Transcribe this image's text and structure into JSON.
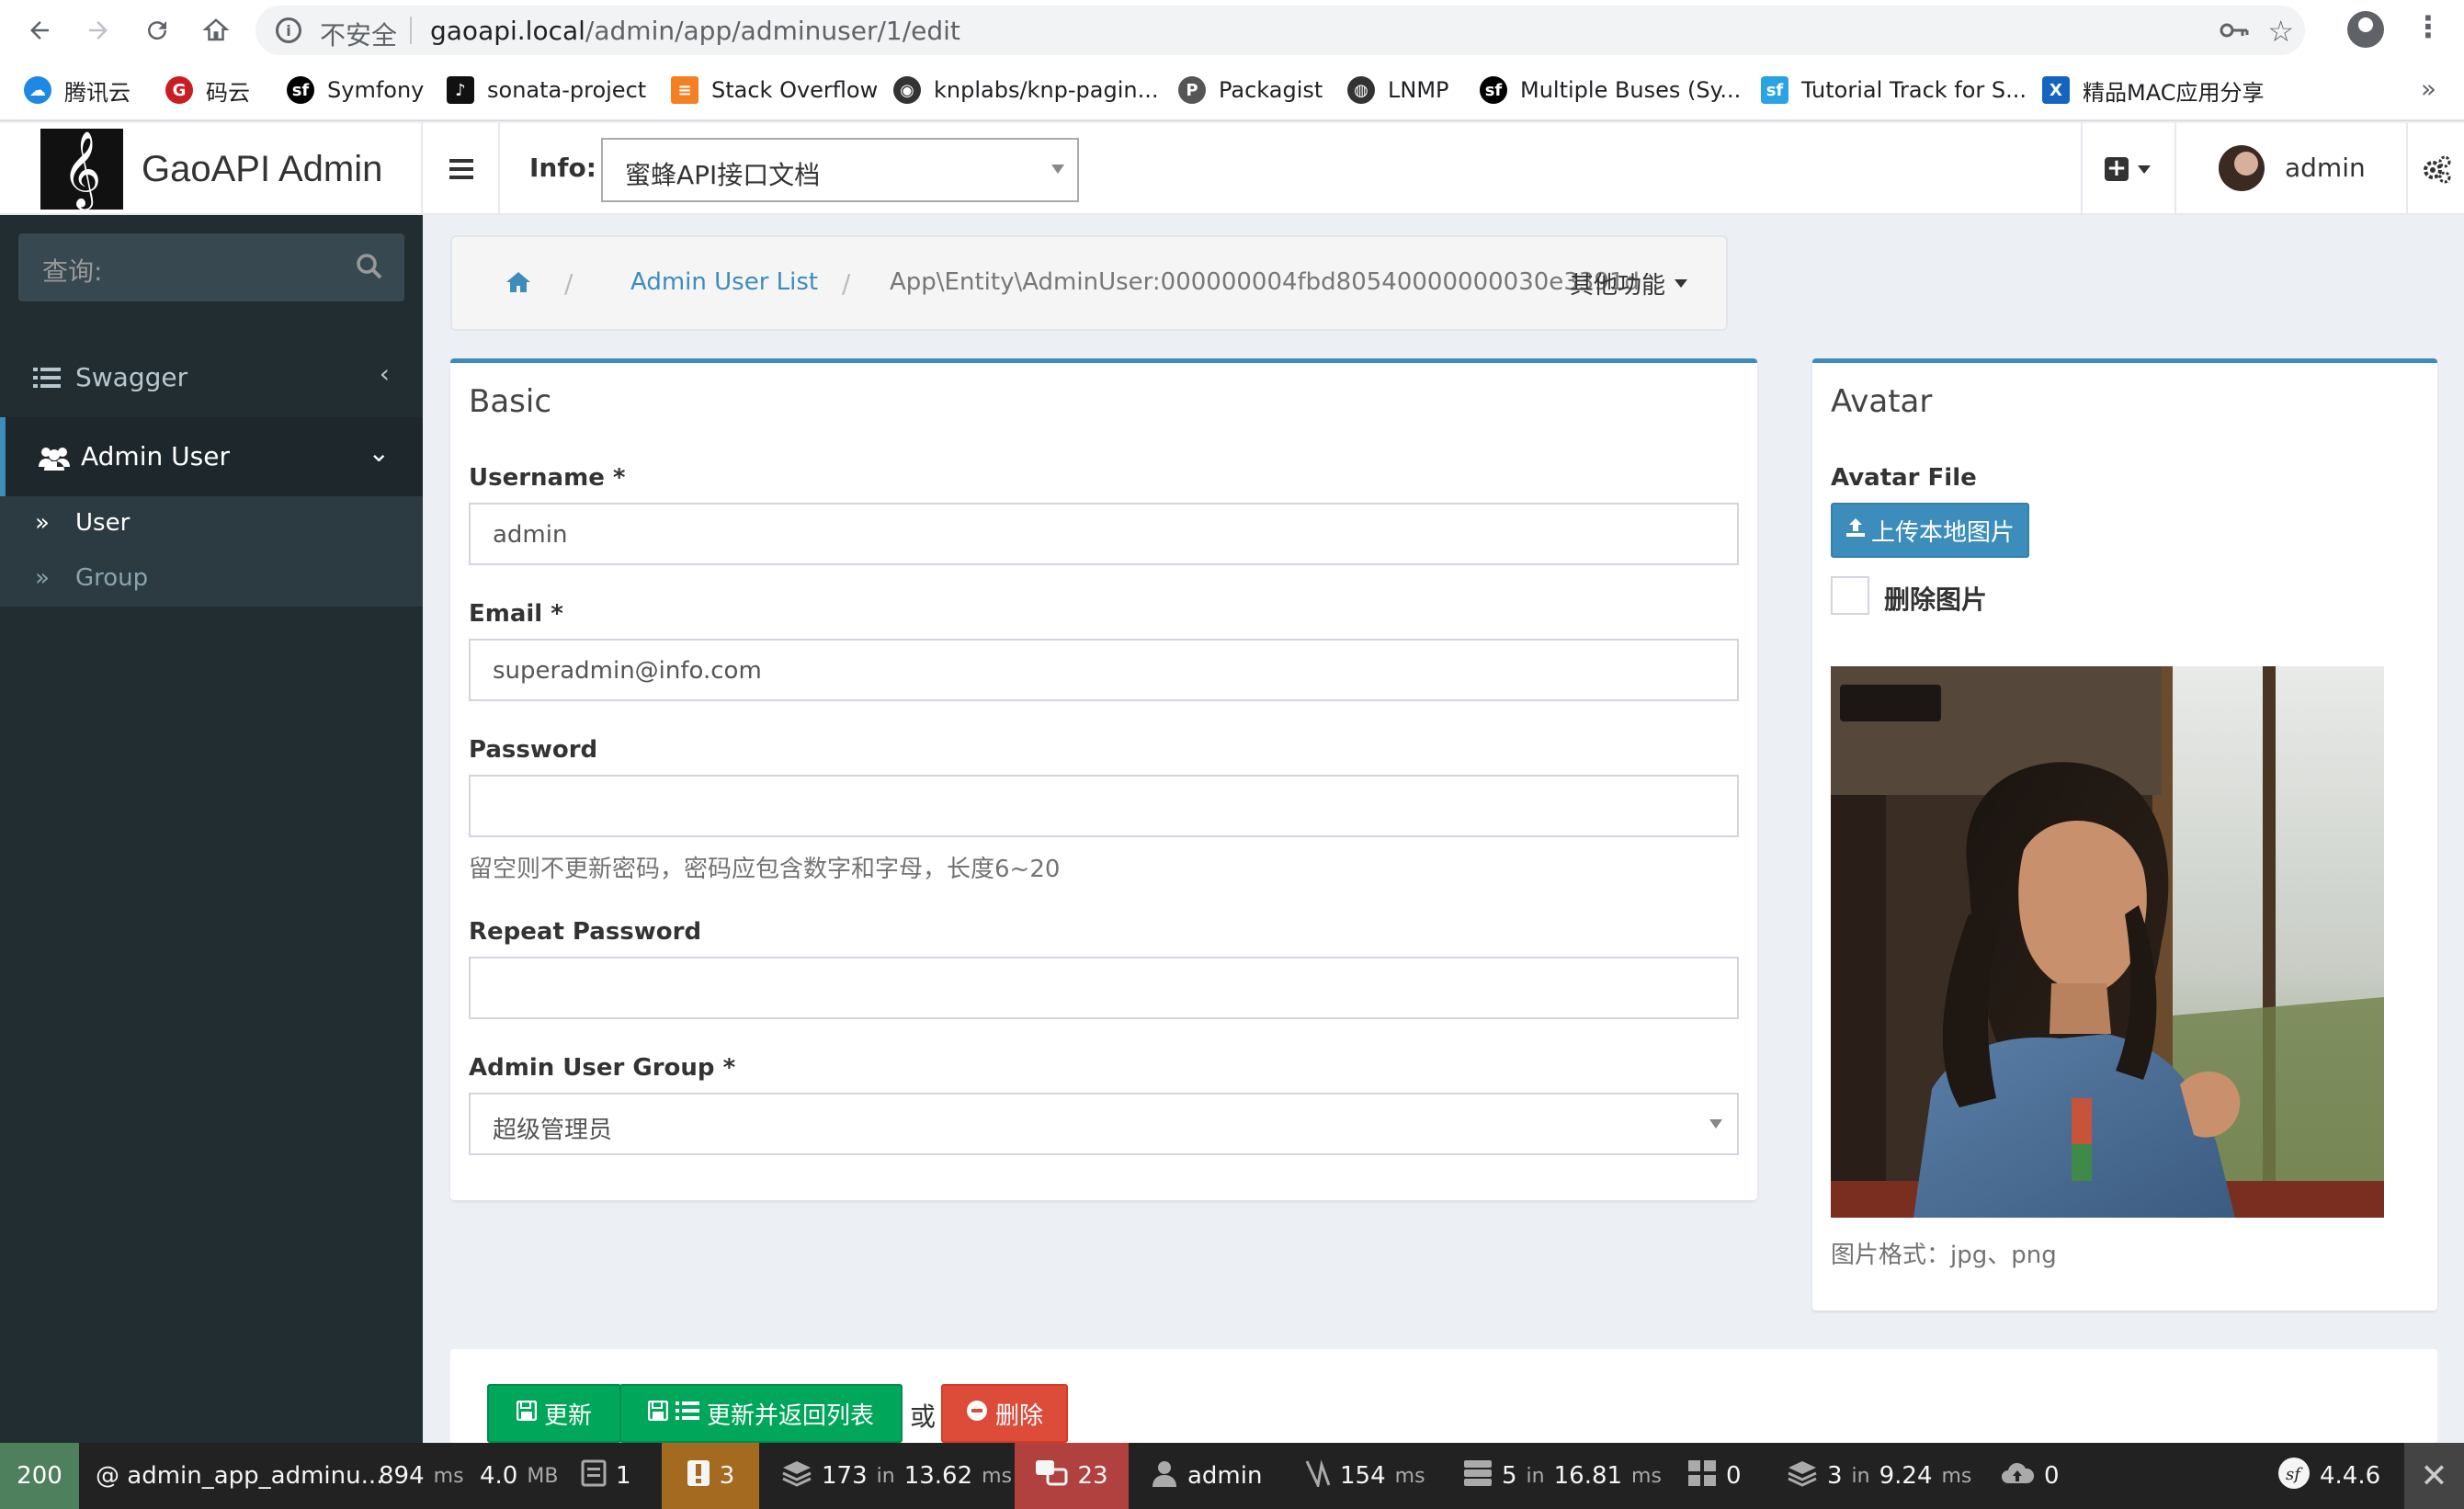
{
  "browser": {
    "insecure_label": "不安全",
    "url_host": "gaoapi.local",
    "url_path": "/admin/app/adminuser/1/edit",
    "bookmarks": [
      {
        "label": "腾讯云",
        "icon": "cloud-icon",
        "color": "#1e88e5"
      },
      {
        "label": "码云",
        "icon": "gitee-icon",
        "color": "#c71d23"
      },
      {
        "label": "Symfony",
        "icon": "symfony-icon",
        "color": "#000000"
      },
      {
        "label": "sonata-project",
        "icon": "sonata-icon",
        "color": "#111111"
      },
      {
        "label": "Stack Overflow",
        "icon": "stackoverflow-icon",
        "color": "#f48024"
      },
      {
        "label": "knplabs/knp-pagin...",
        "icon": "github-icon",
        "color": "#333333"
      },
      {
        "label": "Packagist",
        "icon": "packagist-icon",
        "color": "#555555"
      },
      {
        "label": "LNMP",
        "icon": "globe-icon",
        "color": "#333333"
      },
      {
        "label": "Multiple Buses (Sy...",
        "icon": "symfony-icon",
        "color": "#000000"
      },
      {
        "label": "Tutorial Track for S...",
        "icon": "sf-cast-icon",
        "color": "#29a3e3"
      },
      {
        "label": "精品MAC应用分享",
        "icon": "x-icon",
        "color": "#1565c0"
      }
    ]
  },
  "header": {
    "brand": "GaoAPI Admin",
    "info_label": "Info:",
    "info_select_value": "蜜蜂API接口文档",
    "username": "admin"
  },
  "sidebar": {
    "search_placeholder": "查询:",
    "items": [
      {
        "label": "Swagger",
        "chevron": "‹"
      },
      {
        "label": "Admin User",
        "chevron": "⌄"
      }
    ],
    "submenu": [
      {
        "label": "User"
      },
      {
        "label": "Group"
      }
    ]
  },
  "breadcrumb": {
    "list": "Admin User List",
    "current": "App\\Entity\\AdminUser:000000004fbd80540000000030e3391d",
    "other": "其他功能"
  },
  "basic": {
    "title": "Basic",
    "username_label": "Username *",
    "username_value": "admin",
    "email_label": "Email *",
    "email_value": "superadmin@info.com",
    "password_label": "Password",
    "password_value": "",
    "password_help": "留空则不更新密码，密码应包含数字和字母，长度6~20",
    "repeat_label": "Repeat Password",
    "repeat_value": "",
    "group_label": "Admin User Group *",
    "group_value": "超级管理员"
  },
  "avatar": {
    "title": "Avatar",
    "file_label": "Avatar File",
    "upload_label": "上传本地图片",
    "delete_label": "删除图片",
    "delete_checked": false,
    "format_text": "图片格式：jpg、png"
  },
  "actions": {
    "update": "更新",
    "update_list": "更新并返回列表",
    "or": "或",
    "delete": "删除"
  },
  "toolbar": {
    "status": "200",
    "route": "@ admin_app_adminu...",
    "time_value": "894",
    "time_unit": "ms",
    "memory_value": "4.0",
    "memory_unit": "MB",
    "forms_count": "1",
    "warnings_count": "3",
    "cache_calls": "173",
    "cache_in": "in",
    "cache_time": "13.62",
    "cache_unit": "ms",
    "translations": "23",
    "user": "admin",
    "events_time": "154",
    "events_unit": "ms",
    "db_queries": "5",
    "db_in": "in",
    "db_time": "16.81",
    "db_unit": "ms",
    "twig_count": "0",
    "doctrine_queries": "3",
    "doctrine_in": "in",
    "doctrine_time": "9.24",
    "doctrine_unit": "ms",
    "http_count": "0",
    "symfony_version": "4.4.6",
    "status_color": "#4f805d",
    "warn_color": "#a46a1f",
    "trans_color": "#b0413e"
  }
}
